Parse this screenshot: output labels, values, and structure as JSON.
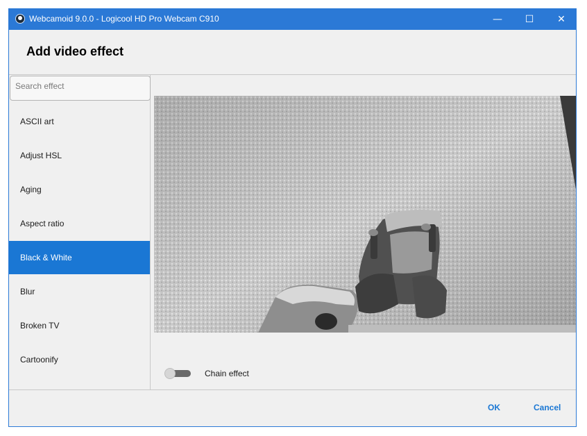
{
  "window": {
    "title": "Webcamoid 9.0.0 - Logicool HD Pro Webcam C910"
  },
  "controls": {
    "minimize": "—",
    "maximize": "☐",
    "close": "✕"
  },
  "dialog": {
    "heading": "Add video effect"
  },
  "search": {
    "placeholder": "Search effect"
  },
  "effects": [
    {
      "label": "ASCII art"
    },
    {
      "label": "Adjust HSL"
    },
    {
      "label": "Aging"
    },
    {
      "label": "Aspect ratio"
    },
    {
      "label": "Black & White",
      "selected": true
    },
    {
      "label": "Blur"
    },
    {
      "label": "Broken TV"
    },
    {
      "label": "Cartoonify"
    }
  ],
  "chain": {
    "label": "Chain effect",
    "enabled": false
  },
  "footer": {
    "ok": "OK",
    "cancel": "Cancel"
  },
  "colors": {
    "accent": "#1a77d4",
    "titlebar": "#2b79d6",
    "background": "#f0f0f0"
  },
  "icons": {
    "app": "webcamoid-app-icon"
  }
}
